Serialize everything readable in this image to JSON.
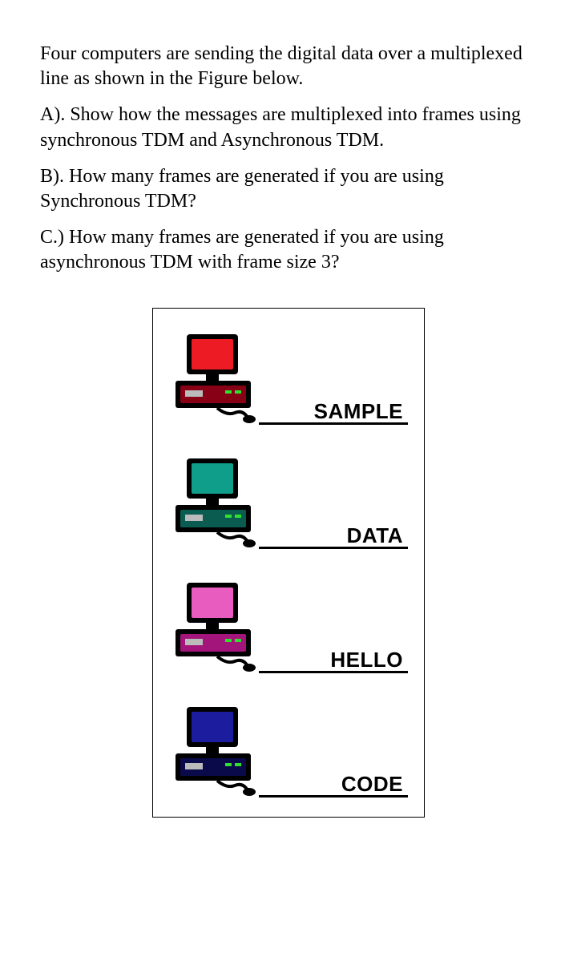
{
  "paragraphs": {
    "intro": "Four computers are sending the digital data over a multiplexed line as shown in the  Figure below.",
    "a": " A). Show how the messages are multiplexed into frames using synchronous TDM and Asynchronous TDM.",
    "b": "B). How many frames are generated if you are using Synchronous TDM?",
    "c": "C.) How many frames are generated if you are using asynchronous TDM with frame size 3?"
  },
  "computers": [
    {
      "name": "computer-1",
      "label": "SAMPLE",
      "screenFill": "#ed1c24",
      "baseFill": "#880015"
    },
    {
      "name": "computer-2",
      "label": "DATA",
      "screenFill": "#0f9e89",
      "baseFill": "#0a5c50"
    },
    {
      "name": "computer-3",
      "label": "HELLO",
      "screenFill": "#e85bbf",
      "baseFill": "#a3157a"
    },
    {
      "name": "computer-4",
      "label": "CODE",
      "screenFill": "#1c1c9e",
      "baseFill": "#0a0a4a"
    }
  ]
}
